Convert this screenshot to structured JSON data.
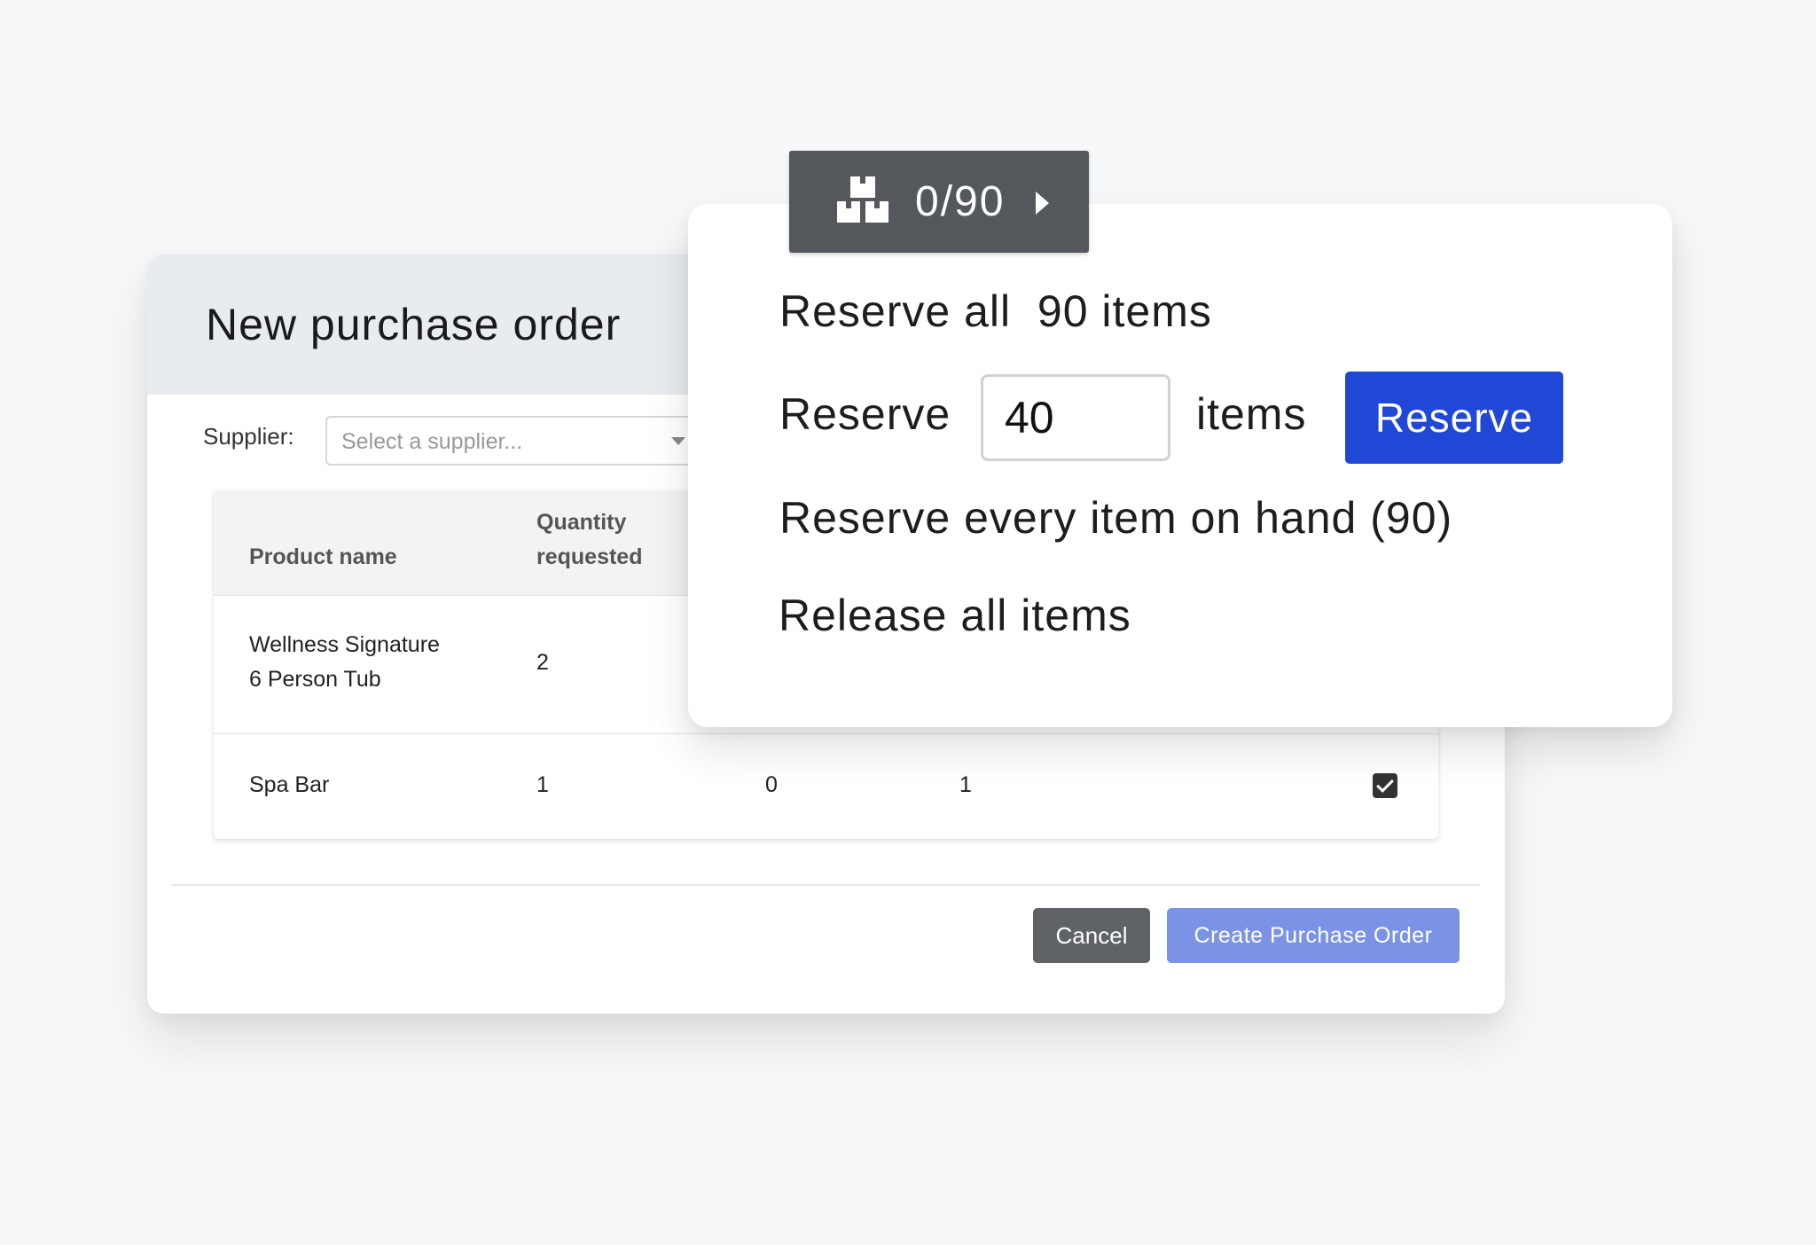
{
  "purchase_order": {
    "title": "New purchase order",
    "supplier_label": "Supplier:",
    "supplier_placeholder": "Select a supplier...",
    "table": {
      "headers": [
        "Product name",
        "Quantity requested"
      ],
      "header_quantity_line1": "Quantity",
      "header_quantity_line2": "requested",
      "rows": [
        {
          "name_line1": "Wellness Signature",
          "name_line2": "6 Person Tub",
          "quantity": "2"
        },
        {
          "name": "Spa Bar",
          "quantity": "1",
          "col3": "0",
          "col4": "1",
          "checked": true
        }
      ]
    },
    "cancel_label": "Cancel",
    "create_label": "Create Purchase Order"
  },
  "reserve_popover": {
    "counter": "0/90",
    "reserve_all_prefix": "Reserve all",
    "reserve_all_count": "90 items",
    "reserve_label": "Reserve",
    "quantity_value": "40",
    "items_label": "items",
    "reserve_button": "Reserve",
    "reserve_on_hand": "Reserve every item on hand",
    "on_hand_count": "(90)",
    "release_all": "Release all items"
  },
  "colors": {
    "primary_button": "#2047d6",
    "create_button": "#7b93e6",
    "cancel_button": "#5f6266",
    "counter_tab": "#54575c"
  },
  "icons": [
    "boxes-icon",
    "play-icon",
    "caret-down-icon",
    "checkbox-checked-icon"
  ]
}
